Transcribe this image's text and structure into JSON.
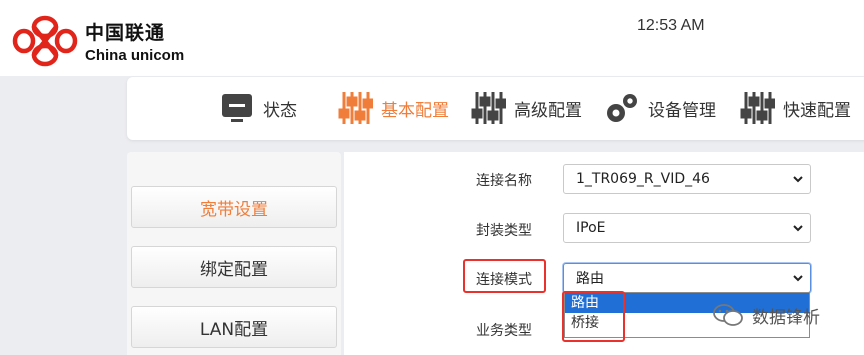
{
  "header": {
    "brand_cn": "中国联通",
    "brand_en": "China unicom",
    "time": "12:53 AM"
  },
  "nav": {
    "items": [
      {
        "label": "状态",
        "icon": "monitor-icon"
      },
      {
        "label": "基本配置",
        "icon": "sliders-icon",
        "active": true
      },
      {
        "label": "高级配置",
        "icon": "sliders-icon"
      },
      {
        "label": "设备管理",
        "icon": "gears-icon"
      },
      {
        "label": "快速配置",
        "icon": "sliders-icon"
      }
    ]
  },
  "sidebar": {
    "items": [
      {
        "label": "宽带设置",
        "active": true
      },
      {
        "label": "绑定配置"
      },
      {
        "label": "LAN配置"
      }
    ]
  },
  "form": {
    "connection_name": {
      "label": "连接名称",
      "value": "1_TR069_R_VID_46"
    },
    "encap_type": {
      "label": "封装类型",
      "value": "IPoE"
    },
    "connection_mode": {
      "label": "连接模式",
      "value": "路由"
    },
    "service_type": {
      "label": "业务类型"
    }
  },
  "dropdown": {
    "options": [
      "路由",
      "桥接"
    ],
    "selected": "路由"
  },
  "watermark": {
    "text": "数据锋析"
  },
  "colors": {
    "accent": "#f07d3a",
    "highlight": "#e8322b",
    "selection": "#1f6fd6"
  }
}
